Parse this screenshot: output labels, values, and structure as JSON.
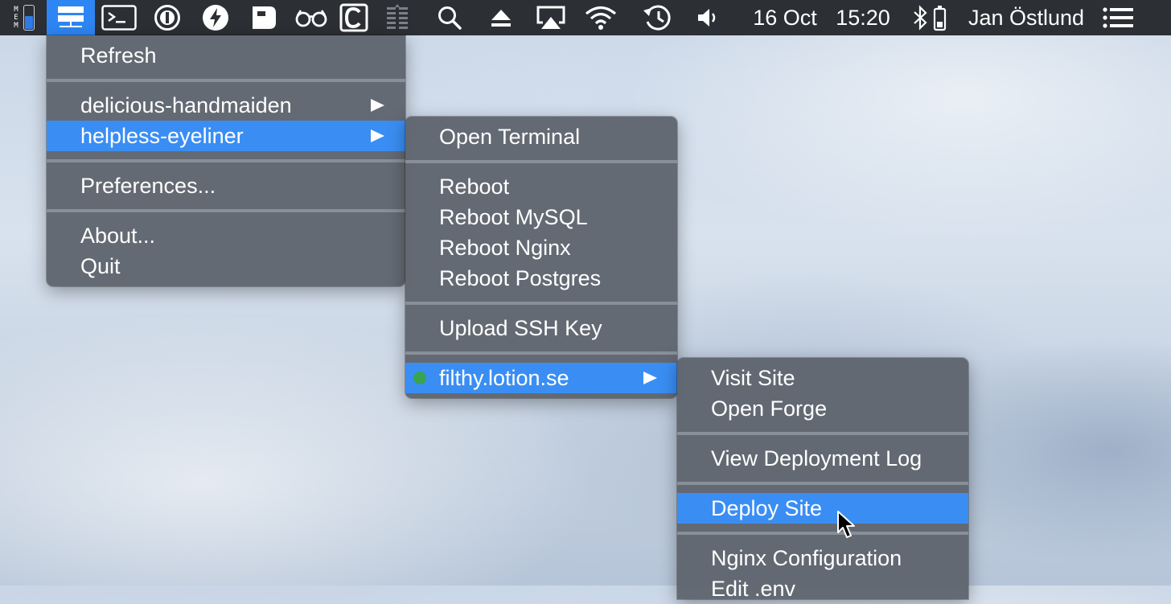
{
  "menubar": {
    "mem_label": "M E M",
    "mem_fill_fraction": 0.55,
    "icons": [
      "mem-gauge-icon",
      "server-icon",
      "terminal-icon",
      "info-icon",
      "bolt-icon",
      "drive-icon",
      "glasses-icon",
      "c-icon",
      "dim-gauge-icon",
      "search-icon",
      "eject-icon",
      "airplay-icon",
      "wifi-icon",
      "time-machine-icon",
      "volume-icon",
      "bluetooth-icon",
      "battery-icon",
      "menu-list-icon"
    ],
    "date": "16 Oct",
    "time": "15:20",
    "user": "Jan Östlund",
    "accent": "#2d86f3"
  },
  "menu1": {
    "refresh": "Refresh",
    "server1": "delicious-handmaiden",
    "server2": "helpless-eyeliner",
    "preferences": "Preferences...",
    "about": "About...",
    "quit": "Quit"
  },
  "menu2": {
    "open_terminal": "Open Terminal",
    "reboot": "Reboot",
    "reboot_mysql": "Reboot MySQL",
    "reboot_nginx": "Reboot Nginx",
    "reboot_postgres": "Reboot Postgres",
    "upload_ssh_key": "Upload SSH Key",
    "site": "filthy.lotion.se",
    "site_status_color": "#3aa351"
  },
  "menu3": {
    "visit_site": "Visit Site",
    "open_forge": "Open Forge",
    "view_deployment_log": "View Deployment Log",
    "deploy_site": "Deploy Site",
    "nginx_configuration": "Nginx Configuration",
    "edit_env": "Edit .env"
  },
  "highlight_color": "#3a8ef3"
}
